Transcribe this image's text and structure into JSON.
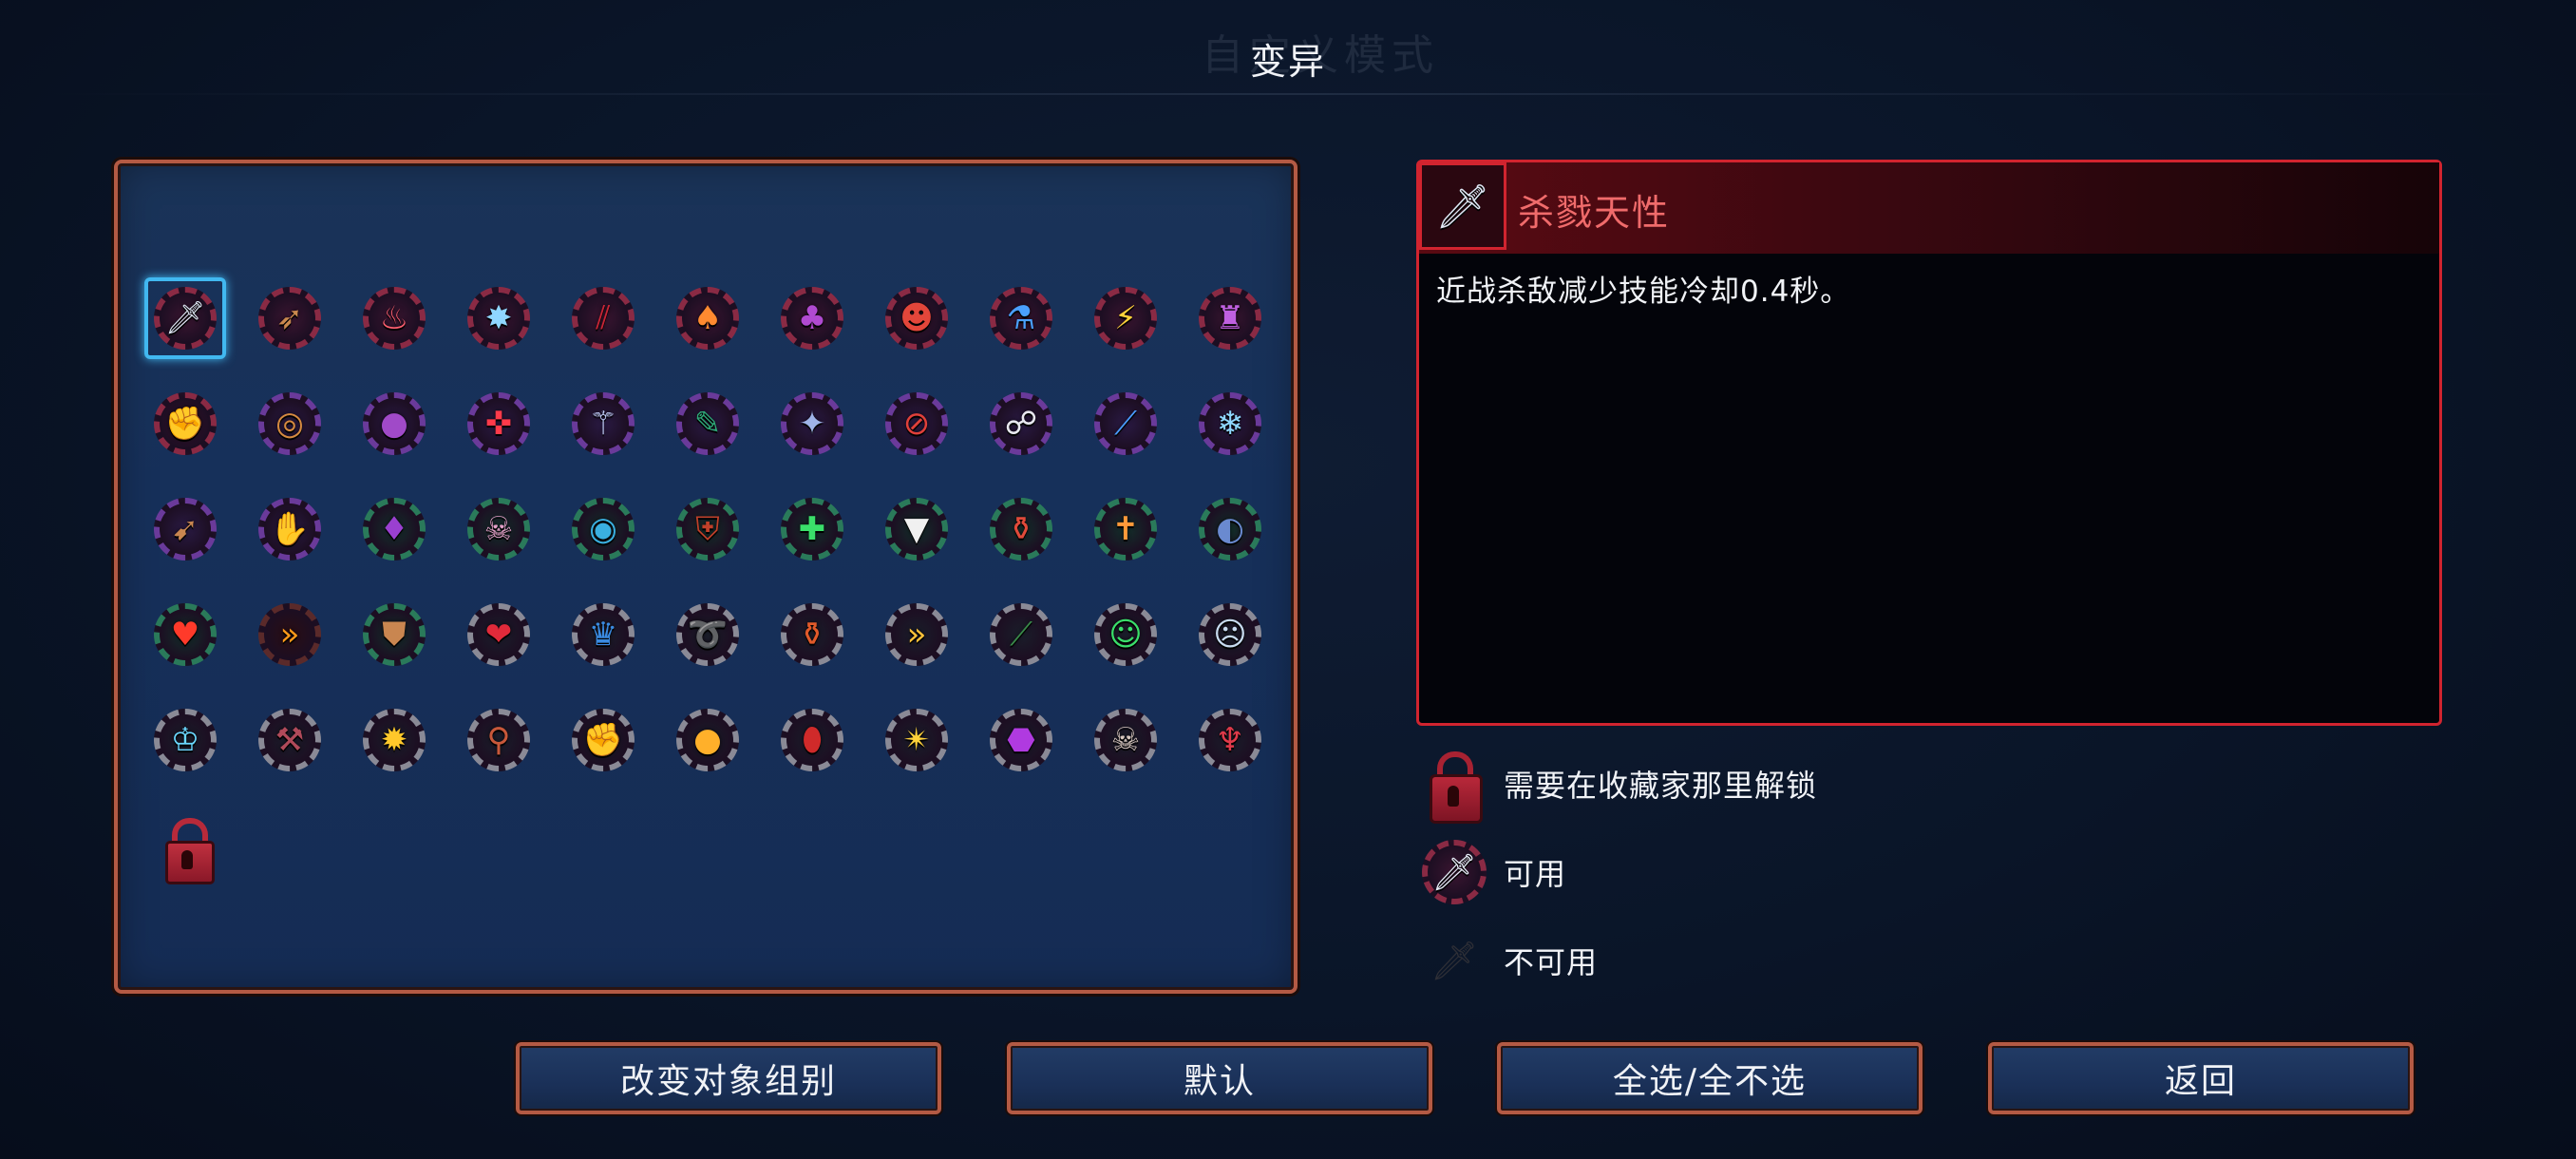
{
  "page_title": "变异",
  "background_ghost_text": "自定义模式",
  "mutation_grid": {
    "rows": [
      [
        {
          "icon": "sword-icon",
          "glyph": "🗡",
          "ring": "#8a2a44",
          "bg": "#3a1530",
          "fg": "#dfe8f5",
          "selected": true
        },
        {
          "icon": "crossbow-icon",
          "glyph": "➶",
          "ring": "#8a2a44",
          "bg": "#3a1530",
          "fg": "#c9894e"
        },
        {
          "icon": "rage-icon",
          "glyph": "♨",
          "ring": "#8a2a44",
          "bg": "#3a1530",
          "fg": "#ff6070"
        },
        {
          "icon": "frost-scythe-icon",
          "glyph": "✸",
          "ring": "#8a2a44",
          "bg": "#3a1530",
          "fg": "#8fd7ff"
        },
        {
          "icon": "claw-slash-icon",
          "glyph": "⫽",
          "ring": "#8a2a44",
          "bg": "#3a1530",
          "fg": "#c82536"
        },
        {
          "icon": "potion-icon",
          "glyph": "♠",
          "ring": "#8a2a44",
          "bg": "#3a1530",
          "fg": "#ff8a30"
        },
        {
          "icon": "cauldron-icon",
          "glyph": "♣",
          "ring": "#8a2a44",
          "bg": "#3a1530",
          "fg": "#b04ad0"
        },
        {
          "icon": "demon-head-icon",
          "glyph": "☻",
          "ring": "#8a2a44",
          "bg": "#3a1530",
          "fg": "#e3463a"
        },
        {
          "icon": "blue-vial-icon",
          "glyph": "⚗",
          "ring": "#8a2a44",
          "bg": "#3a1530",
          "fg": "#4aa0ff"
        },
        {
          "icon": "lightning-icon",
          "glyph": "⚡",
          "ring": "#8a2a44",
          "bg": "#3a1530",
          "fg": "#ffd23a"
        },
        {
          "icon": "wizard-hat-icon",
          "glyph": "♜",
          "ring": "#8a2a44",
          "bg": "#3a1530",
          "fg": "#c060e0"
        }
      ],
      [
        {
          "icon": "fist-dagger-icon",
          "glyph": "✊",
          "ring": "#8a2a44",
          "bg": "#3a1530",
          "fg": "#c98650"
        },
        {
          "icon": "ring-icon",
          "glyph": "◎",
          "ring": "#6a3a9a",
          "bg": "#2a1a44",
          "fg": "#d58a40"
        },
        {
          "icon": "bomb-icon",
          "glyph": "●",
          "ring": "#6a3a9a",
          "bg": "#2a1a44",
          "fg": "#a04ac8"
        },
        {
          "icon": "target-icon",
          "glyph": "✜",
          "ring": "#6a3a9a",
          "bg": "#2a1a44",
          "fg": "#ff3a4a"
        },
        {
          "icon": "trident-icon",
          "glyph": "⚚",
          "ring": "#6a3a9a",
          "bg": "#2a1a44",
          "fg": "#c6d4ff"
        },
        {
          "icon": "scroll-icon",
          "glyph": "✎",
          "ring": "#6a3a9a",
          "bg": "#2a1a44",
          "fg": "#2ea877"
        },
        {
          "icon": "spike-trap-icon",
          "glyph": "✦",
          "ring": "#6a3a9a",
          "bg": "#2a1a44",
          "fg": "#9fb4e8"
        },
        {
          "icon": "no-arrow-icon",
          "glyph": "⊘",
          "ring": "#6a3a9a",
          "bg": "#2a1a44",
          "fg": "#e0403a"
        },
        {
          "icon": "skeleton-hand-icon",
          "glyph": "☍",
          "ring": "#6a3a9a",
          "bg": "#2a1a44",
          "fg": "#e8e8f0"
        },
        {
          "icon": "blue-blade-icon",
          "glyph": "⟋",
          "ring": "#6a3a9a",
          "bg": "#2a1a44",
          "fg": "#4a9cff"
        },
        {
          "icon": "ice-bow-icon",
          "glyph": "❄",
          "ring": "#6a3a9a",
          "bg": "#2a1a44",
          "fg": "#8fd7ff"
        }
      ],
      [
        {
          "icon": "bow-icon",
          "glyph": "➹",
          "ring": "#6a3a9a",
          "bg": "#2a1a44",
          "fg": "#c98650"
        },
        {
          "icon": "glove-icon",
          "glyph": "✋",
          "ring": "#6a3a9a",
          "bg": "#2a1a44",
          "fg": "#c98650"
        },
        {
          "icon": "purple-bag-icon",
          "glyph": "♦",
          "ring": "#2a7a5a",
          "bg": "#12302a",
          "fg": "#9a40d0"
        },
        {
          "icon": "skull-crossbones-icon",
          "glyph": "☠",
          "ring": "#2a7a5a",
          "bg": "#12302a",
          "fg": "#e3a0c8"
        },
        {
          "icon": "blue-orb-icon",
          "glyph": "◉",
          "ring": "#2a7a5a",
          "bg": "#12302a",
          "fg": "#3ab0e0"
        },
        {
          "icon": "shield-icon",
          "glyph": "⛨",
          "ring": "#2a7a5a",
          "bg": "#12302a",
          "fg": "#c0402a"
        },
        {
          "icon": "heal-shield-icon",
          "glyph": "✚",
          "ring": "#2a7a5a",
          "bg": "#12302a",
          "fg": "#3adf6a"
        },
        {
          "icon": "vampire-fangs-icon",
          "glyph": "▼",
          "ring": "#2a7a5a",
          "bg": "#12302a",
          "fg": "#f0f0f0"
        },
        {
          "icon": "health-flask-icon",
          "glyph": "⚱",
          "ring": "#2a7a5a",
          "bg": "#12302a",
          "fg": "#e04a3a"
        },
        {
          "icon": "torch-icon",
          "glyph": "✝",
          "ring": "#2a7a5a",
          "bg": "#12302a",
          "fg": "#ff9a3a"
        },
        {
          "icon": "spiral-shield-icon",
          "glyph": "◐",
          "ring": "#2a7a5a",
          "bg": "#12302a",
          "fg": "#6a8ad0"
        }
      ],
      [
        {
          "icon": "fire-spirit-icon",
          "glyph": "♥",
          "ring": "#2a7a5a",
          "bg": "#12302a",
          "fg": "#ff3a2a"
        },
        {
          "icon": "speed-chevrons-icon",
          "glyph": "»",
          "ring": "#5a2a2a",
          "bg": "#2a0e14",
          "fg": "#ff9a1a"
        },
        {
          "icon": "fist-shield-icon",
          "glyph": "⛊",
          "ring": "#2a7a5a",
          "bg": "#12302a",
          "fg": "#c98650"
        },
        {
          "icon": "red-heart-icon",
          "glyph": "❤",
          "ring": "#8a8a96",
          "bg": "#1a1e2a",
          "fg": "#e02a3a"
        },
        {
          "icon": "blue-armor-icon",
          "glyph": "♛",
          "ring": "#8a8a96",
          "bg": "#1a1e2a",
          "fg": "#3a8ae0"
        },
        {
          "icon": "dash-swirl-icon",
          "glyph": "➰",
          "ring": "#8a8a96",
          "bg": "#1a1e2a",
          "fg": "#ffc23a"
        },
        {
          "icon": "red-potion-icon",
          "glyph": "⚱",
          "ring": "#8a8a96",
          "bg": "#1a1e2a",
          "fg": "#e05a2a"
        },
        {
          "icon": "double-chevron-icon",
          "glyph": "»",
          "ring": "#8a8a96",
          "bg": "#1a1e2a",
          "fg": "#ffc23a"
        },
        {
          "icon": "green-blade-icon",
          "glyph": "⟋",
          "ring": "#8a8a96",
          "bg": "#1a1e2a",
          "fg": "#3a8a4a"
        },
        {
          "icon": "green-skull-icon",
          "glyph": "☺",
          "ring": "#8a8a96",
          "bg": "#1a1e2a",
          "fg": "#3adf6a"
        },
        {
          "icon": "blue-skull-icon",
          "glyph": "☹",
          "ring": "#8a8a96",
          "bg": "#1a1e2a",
          "fg": "#c8dcf0"
        }
      ],
      [
        {
          "icon": "crystal-crown-icon",
          "glyph": "♔",
          "ring": "#8a8a96",
          "bg": "#1a1e2a",
          "fg": "#6ad8ff"
        },
        {
          "icon": "hammer-icon",
          "glyph": "⚒",
          "ring": "#8a8a96",
          "bg": "#1a1e2a",
          "fg": "#b04a5a"
        },
        {
          "icon": "burst-star-icon",
          "glyph": "✹",
          "ring": "#8a8a96",
          "bg": "#1a1e2a",
          "fg": "#ffc82a"
        },
        {
          "icon": "meat-icon",
          "glyph": "⚲",
          "ring": "#8a8a96",
          "bg": "#1a1e2a",
          "fg": "#c8583a"
        },
        {
          "icon": "golden-gauntlet-icon",
          "glyph": "✊",
          "ring": "#8a8a96",
          "bg": "#1a1e2a",
          "fg": "#ffb02a"
        },
        {
          "icon": "gold-pouch-icon",
          "glyph": "●",
          "ring": "#8a8a96",
          "bg": "#1a1e2a",
          "fg": "#ffb02a"
        },
        {
          "icon": "blood-drop-icon",
          "glyph": "⬮",
          "ring": "#8a8a96",
          "bg": "#1a1e2a",
          "fg": "#d02a2a"
        },
        {
          "icon": "golden-sword-icon",
          "glyph": "✴",
          "ring": "#8a8a96",
          "bg": "#1a1e2a",
          "fg": "#ffd23a"
        },
        {
          "icon": "purple-cauldron-icon",
          "glyph": "⬣",
          "ring": "#8a8a96",
          "bg": "#1a1e2a",
          "fg": "#b03ae0"
        },
        {
          "icon": "halo-skull-icon",
          "glyph": "☠",
          "ring": "#8a8a96",
          "bg": "#1a1e2a",
          "fg": "#d8c8c0"
        },
        {
          "icon": "demon-mask-icon",
          "glyph": "♆",
          "ring": "#8a8a96",
          "bg": "#1a1e2a",
          "fg": "#e03a4a"
        }
      ]
    ],
    "lock_icon": "padlock-icon"
  },
  "detail": {
    "icon": "sword-icon",
    "glyph": "🗡",
    "title": "杀戮天性",
    "description": "近战杀敌减少技能冷却0.4秒。"
  },
  "legend": {
    "locked": {
      "icon": "padlock-icon",
      "label": "需要在收藏家那里解锁"
    },
    "available": {
      "icon": "sword-icon",
      "glyph": "🗡",
      "label": "可用"
    },
    "unavailable": {
      "icon": "sword-silhouette-icon",
      "glyph": "🗡",
      "label": "不可用"
    }
  },
  "buttons": {
    "change_group": "改变对象组别",
    "default": "默认",
    "select_all": "全选/全不选",
    "back": "返回"
  },
  "colors": {
    "panel_border": "#b45a44",
    "detail_border": "#d1242f",
    "selection_highlight": "#41b8f0",
    "detail_title": "#f06b6b"
  }
}
